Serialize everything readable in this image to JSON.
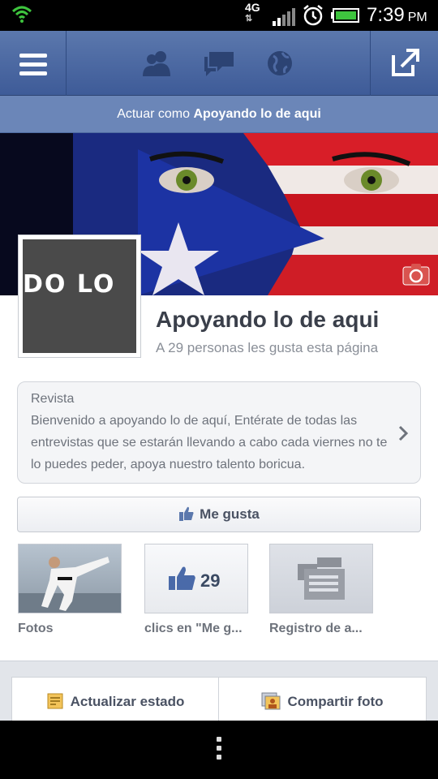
{
  "status_bar": {
    "network": "4G",
    "time": "7:39",
    "ampm": "PM",
    "icons": [
      "wifi-icon",
      "signal-icon",
      "alarm-icon",
      "battery-icon"
    ]
  },
  "header": {
    "icons": [
      "menu-icon",
      "friend-requests-icon",
      "messages-icon",
      "notifications-icon",
      "share-icon"
    ]
  },
  "acting_as": {
    "prefix": "Actuar como",
    "name": "Apoyando lo de aqui"
  },
  "page": {
    "profile_text": "DO LO",
    "name": "Apoyando lo de aqui",
    "likes_text": "A 29 personas les gusta esta página"
  },
  "about": {
    "title": "Revista",
    "text": "Bienvenido a apoyando lo de aquí, Entérate de todas las entrevistas que se estarán llevando a cabo cada viernes no te lo puedes peder, apoya nuestro talento boricua."
  },
  "like_button": {
    "label": "Me gusta"
  },
  "tiles": [
    {
      "label": "Fotos"
    },
    {
      "label": "clics en \"Me g...",
      "count": "29"
    },
    {
      "label": "Registro de a..."
    }
  ],
  "actions": [
    {
      "label": "Actualizar estado"
    },
    {
      "label": "Compartir foto"
    }
  ],
  "colors": {
    "fb_blue": "#3e5b98",
    "acting_bar": "#6b86b8",
    "text_gray": "#6e737c"
  }
}
